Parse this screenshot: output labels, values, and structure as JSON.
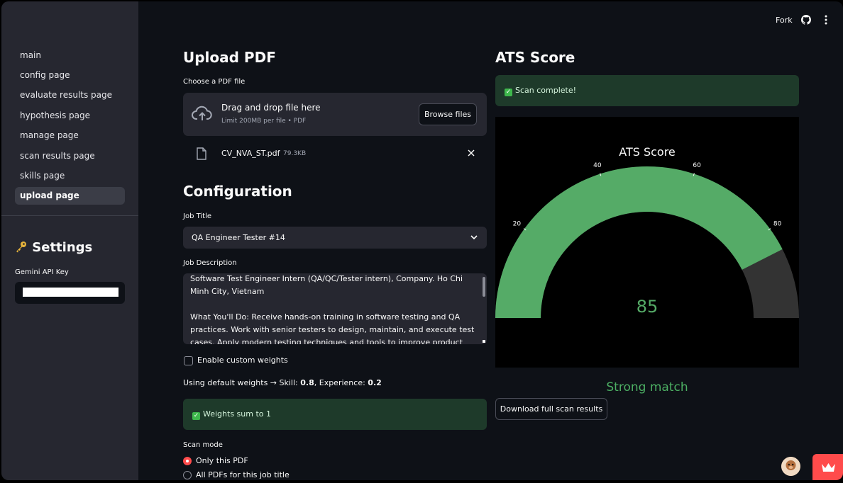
{
  "sidebar": {
    "nav_items": [
      {
        "label": "main"
      },
      {
        "label": "config page"
      },
      {
        "label": "evaluate results page"
      },
      {
        "label": "hypothesis page"
      },
      {
        "label": "manage page"
      },
      {
        "label": "scan results page"
      },
      {
        "label": "skills page"
      },
      {
        "label": "upload page",
        "active": true
      }
    ],
    "settings_title": "Settings",
    "settings_icon": "key-icon",
    "api_key_label": "Gemini API Key"
  },
  "topbar": {
    "fork_label": "Fork",
    "github_icon": "github-icon",
    "menu_icon": "kebab-menu-icon"
  },
  "upload": {
    "title": "Upload PDF",
    "file_label": "Choose a PDF file",
    "dropzone_title": "Drag and drop file here",
    "dropzone_subtitle": "Limit 200MB per file • PDF",
    "browse_label": "Browse files",
    "file_name": "CV_NVA_ST.pdf",
    "file_size": "79.3KB"
  },
  "configuration": {
    "title": "Configuration",
    "job_title_label": "Job Title",
    "job_title_value": "QA Engineer Tester #14",
    "job_desc_label": "Job Description",
    "job_desc_value": "Software Test Engineer Intern (QA/QC/Tester intern), Company. Ho Chi Minh City, Vietnam\n\nWhat You'll Do: Receive hands-on training in software testing and QA practices. Work with senior testers to design, maintain, and execute test cases. Apply modern testing techniques and tools to improve product",
    "custom_weights_label": "Enable custom weights",
    "weights_prefix": "Using default weights → Skill: ",
    "skill_weight": "0.8",
    "experience_label": ", Experience: ",
    "experience_weight": "0.2",
    "weights_sum_msg": "Weights sum to 1",
    "scan_mode_label": "Scan mode",
    "scan_modes": [
      {
        "label": "Only this PDF",
        "selected": true
      },
      {
        "label": "All PDFs for this job title",
        "selected": false
      }
    ]
  },
  "ats": {
    "title": "ATS Score",
    "scan_msg": "Scan complete!",
    "match_label": "Strong match",
    "download_label": "Download full scan results"
  },
  "chart_data": {
    "type": "gauge",
    "title": "ATS Score",
    "value": 85,
    "range": [
      0,
      100
    ],
    "ticks": [
      20,
      40,
      60,
      80
    ],
    "bar_color": "#55ab67",
    "track_color": "#333333",
    "value_color": "#55ab67"
  }
}
